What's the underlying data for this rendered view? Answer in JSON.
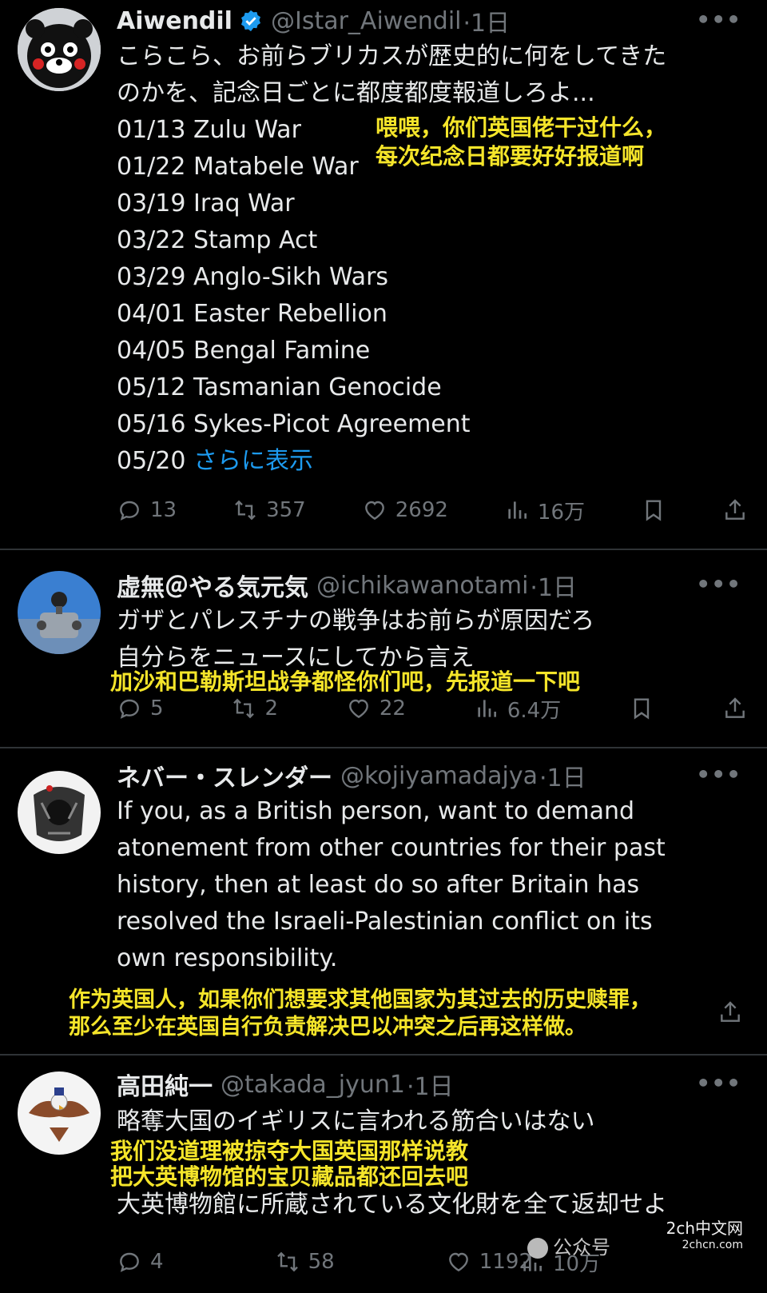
{
  "tweets": [
    {
      "name": "Aiwendil",
      "handle": "@Istar_Aiwendil",
      "time": "·1日",
      "verified": true,
      "lines": [
        "こらこら、お前らブリカスが歴史的に何をしてきた",
        "のかを、記念日ごとに都度都度報道しろよ...",
        "01/13 Zulu War",
        "01/22 Matabele War",
        "03/19 Iraq War",
        "03/22 Stamp Act",
        "03/29 Anglo-Sikh Wars",
        "04/01 Easter Rebellion",
        "04/05 Bengal Famine",
        "05/12 Tasmanian Genocide",
        "05/16 Sykes-Picot Agreement"
      ],
      "last_line_prefix": "05/20 ",
      "show_more": "さらに表示",
      "subtitle": [
        "喂喂，你们英国佬干过什么，",
        "每次纪念日都要好好报道啊"
      ],
      "replies": "13",
      "retweets": "357",
      "likes": "2692",
      "views": "16万"
    },
    {
      "name": "虚無＠やる気元気",
      "handle": "@ichikawanotami",
      "time": "·1日",
      "lines": [
        "ガザとパレスチナの戦争はお前らが原因だろ",
        "自分らをニュースにしてから言え"
      ],
      "subtitle": [
        "加沙和巴勒斯坦战争都怪你们吧，先报道一下吧"
      ],
      "replies": "5",
      "retweets": "2",
      "likes": "22",
      "views": "6.4万"
    },
    {
      "name": "ネバー・スレンダー",
      "handle": "@kojiyamadajya",
      "time": "·1日",
      "lines": [
        "If you, as a British person, want to demand",
        "atonement from other countries for their past",
        "history, then at least do so after Britain has",
        "resolved the Israeli-Palestinian conflict on its",
        "own responsibility."
      ],
      "subtitle": [
        "作为英国人，如果你们想要求其他国家为其过去的历史赎罪，",
        "那么至少在英国自行负责解决巴以冲突之后再这样做。"
      ]
    },
    {
      "name": "高田純一",
      "handle": "@takada_jyun1",
      "time": "·1日",
      "line1": "略奪大国のイギリスに言われる筋合いはない",
      "subtitle": [
        "我们没道理被掠夺大国英国那样说教",
        "把大英博物馆的宝贝藏品都还回去吧"
      ],
      "line2": "大英博物館に所蔵されている文化財を全て返却せよ",
      "replies": "4",
      "retweets": "58",
      "likes": "1192",
      "views": "10万"
    }
  ],
  "watermark": {
    "text": "公众号",
    "badge_line1": "2ch中文网",
    "badge_line2": "2chcn.com"
  },
  "colors": {
    "background": "#000000",
    "text": "#e7e9ea",
    "muted": "#71767b",
    "link": "#1d9bf0",
    "subtitle": "#f5e52a",
    "divider": "#2f3336"
  },
  "icons": [
    "reply-icon",
    "retweet-icon",
    "like-icon",
    "views-icon",
    "bookmark-icon",
    "share-icon",
    "verified-badge-icon",
    "more-icon"
  ]
}
